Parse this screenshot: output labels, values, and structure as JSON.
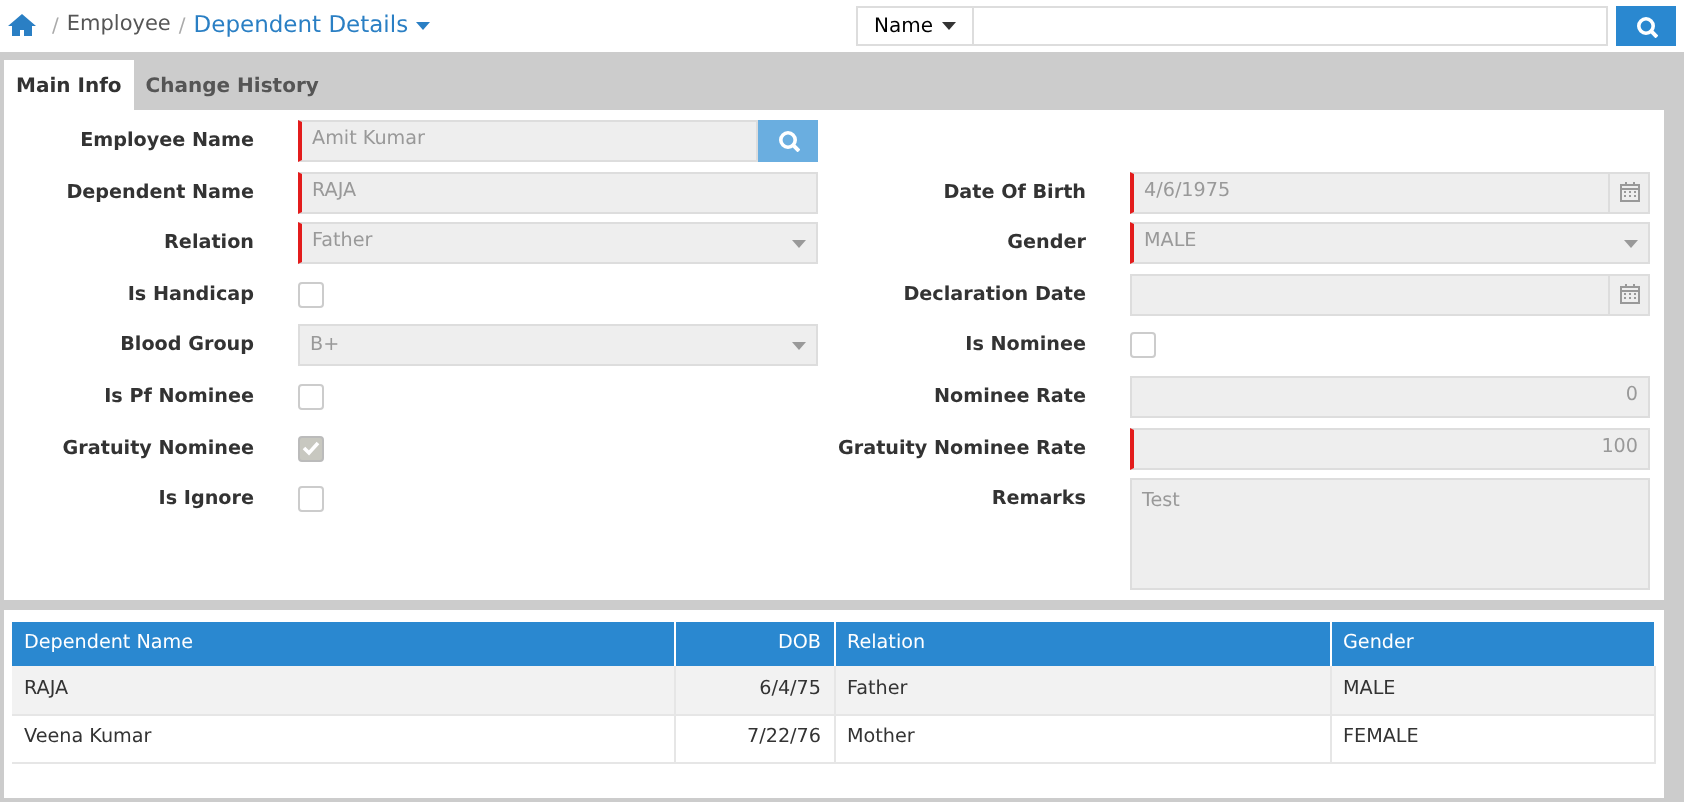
{
  "breadcrumb": {
    "items": [
      {
        "kind": "separator",
        "text": "/"
      },
      {
        "kind": "link",
        "text": "Employee"
      },
      {
        "kind": "separator",
        "text": "/"
      }
    ],
    "current": "Dependent Details"
  },
  "search": {
    "filter": "Name"
  },
  "tabs": [
    {
      "label": "Main Info",
      "selected": true
    },
    {
      "label": "Change History",
      "selected": false
    }
  ],
  "form": {
    "left": [
      {
        "label": "Employee Name",
        "kind": "lookup",
        "value": "Amit Kumar",
        "required": true
      },
      {
        "label": "Dependent Name",
        "kind": "text",
        "value": "RAJA",
        "required": true
      },
      {
        "label": "Relation",
        "kind": "select",
        "value": "Father",
        "required": true
      },
      {
        "label": "Is Handicap",
        "kind": "checkbox",
        "checked": false
      },
      {
        "label": "Blood Group",
        "kind": "select",
        "value": "B+",
        "required": false
      },
      {
        "label": "Is Pf Nominee",
        "kind": "checkbox",
        "checked": false
      },
      {
        "label": "Gratuity Nominee",
        "kind": "checkbox",
        "checked": true
      },
      {
        "label": "Is Ignore",
        "kind": "checkbox",
        "checked": false
      }
    ],
    "right": [
      {
        "label": "Date Of Birth",
        "kind": "date",
        "value": "4/6/1975",
        "required": true
      },
      {
        "label": "Gender",
        "kind": "select",
        "value": "MALE",
        "required": true
      },
      {
        "label": "Declaration Date",
        "kind": "date",
        "required": false
      },
      {
        "label": "Is Nominee",
        "kind": "checkbox",
        "checked": false
      },
      {
        "label": "Nominee Rate",
        "kind": "number",
        "value": "0",
        "required": false
      },
      {
        "label": "Gratuity Nominee Rate",
        "kind": "number",
        "value": "100",
        "required": true
      },
      {
        "label": "Remarks",
        "kind": "textarea",
        "value": "Test",
        "required": false
      }
    ]
  },
  "table": {
    "columns": [
      "Dependent Name",
      "DOB",
      "Relation",
      "Gender"
    ],
    "rows": [
      [
        "RAJA",
        "6/4/75",
        "Father",
        "MALE"
      ],
      [
        "Veena Kumar",
        "7/22/76",
        "Mother",
        "FEMALE"
      ]
    ]
  }
}
